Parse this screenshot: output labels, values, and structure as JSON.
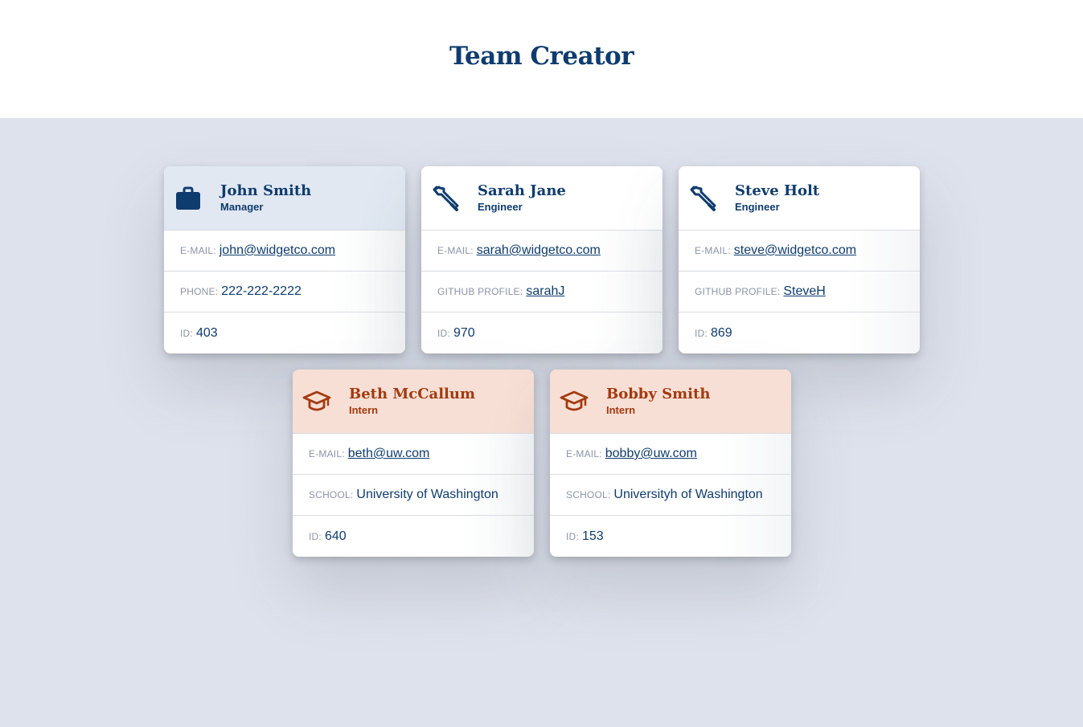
{
  "page": {
    "title": "Team Creator"
  },
  "colors": {
    "primary": "#0f3c6e",
    "intern_accent": "#a33a0f",
    "manager_header": "#e1e8f2",
    "intern_header": "#f7dfd5",
    "background": "#dee2ec"
  },
  "cards": [
    {
      "name": "John Smith",
      "role": "Manager",
      "icon": "briefcase-icon",
      "rows": [
        {
          "label": "E-MAIL:",
          "value": "john@widgetco.com"
        },
        {
          "label": "PHONE:",
          "value": "222-222-2222"
        },
        {
          "label": "ID:",
          "value": "403"
        }
      ]
    },
    {
      "name": "Sarah Jane",
      "role": "Engineer",
      "icon": "wrench-icon",
      "rows": [
        {
          "label": "E-MAIL:",
          "value": "sarah@widgetco.com"
        },
        {
          "label": "GITHUB PROFILE:",
          "value": "sarahJ"
        },
        {
          "label": "ID:",
          "value": "970"
        }
      ]
    },
    {
      "name": "Steve Holt",
      "role": "Engineer",
      "icon": "wrench-icon",
      "rows": [
        {
          "label": "E-MAIL:",
          "value": "steve@widgetco.com"
        },
        {
          "label": "GITHUB PROFILE:",
          "value": "SteveH"
        },
        {
          "label": "ID:",
          "value": "869"
        }
      ]
    },
    {
      "name": "Beth McCallum",
      "role": "Intern",
      "icon": "graduation-cap-icon",
      "rows": [
        {
          "label": "E-MAIL:",
          "value": "beth@uw.com"
        },
        {
          "label": "SCHOOL:",
          "value": "University of Washington"
        },
        {
          "label": "ID:",
          "value": "640"
        }
      ]
    },
    {
      "name": "Bobby Smith",
      "role": "Intern",
      "icon": "graduation-cap-icon",
      "rows": [
        {
          "label": "E-MAIL:",
          "value": "bobby@uw.com"
        },
        {
          "label": "SCHOOL:",
          "value": "Universityh of Washington"
        },
        {
          "label": "ID:",
          "value": "153"
        }
      ]
    }
  ]
}
